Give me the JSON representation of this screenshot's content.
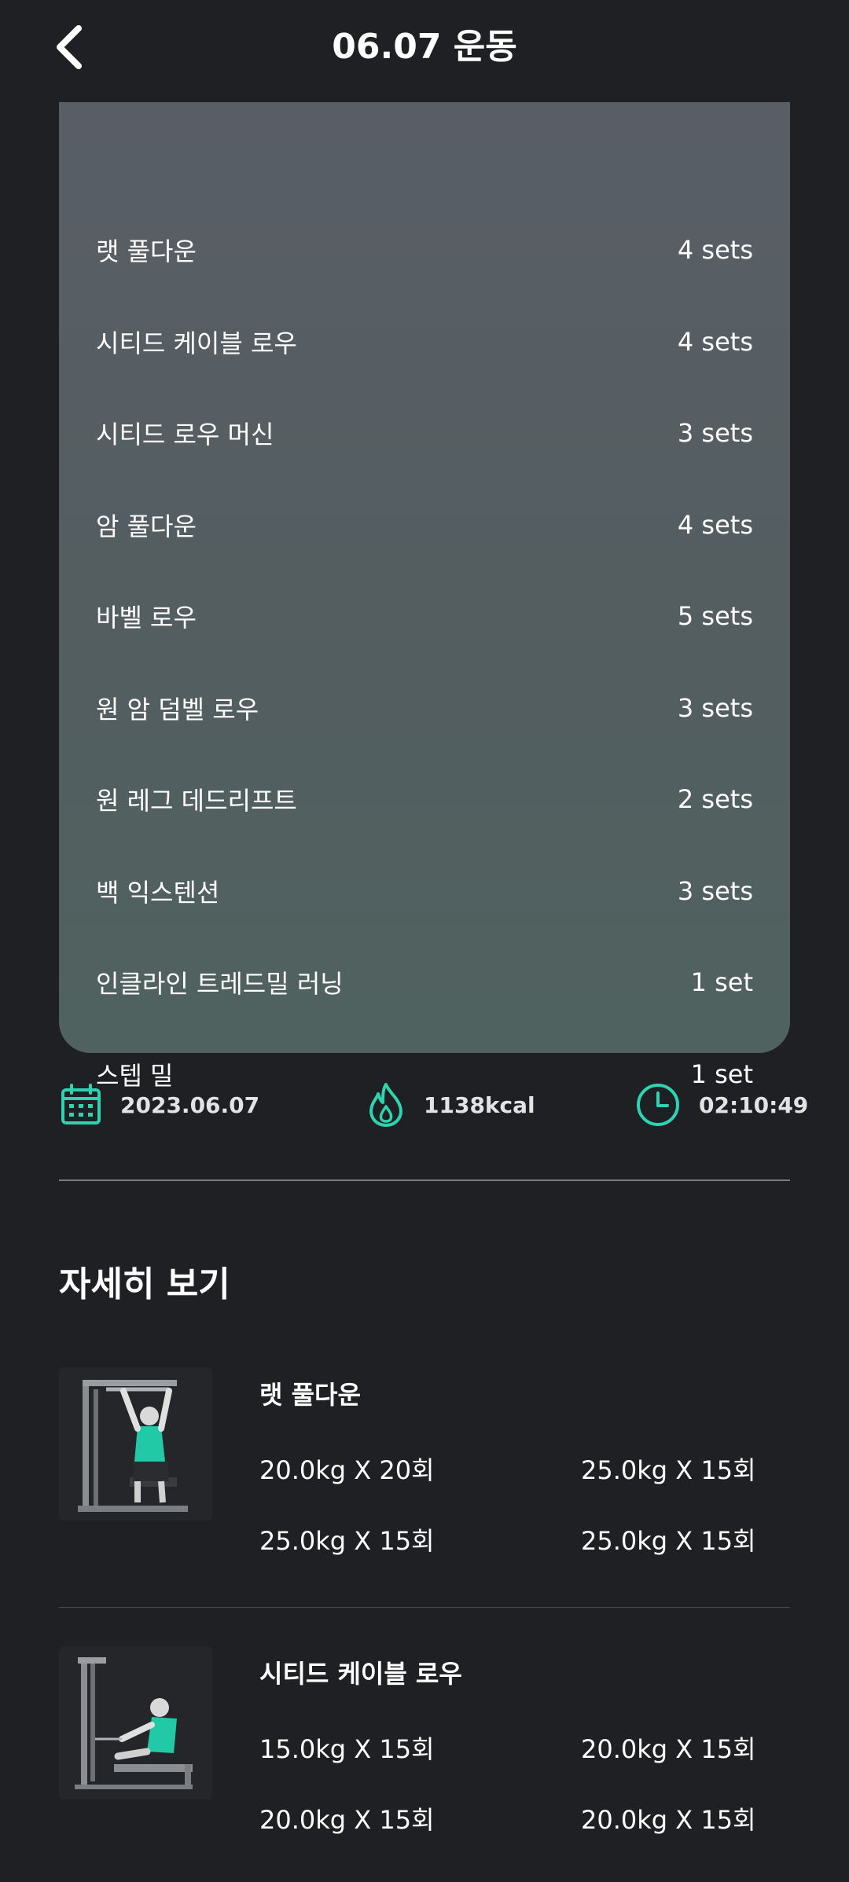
{
  "header": {
    "title": "06.07 운동"
  },
  "summary": {
    "items": [
      {
        "name": "랫 풀다운",
        "sets": "4 sets"
      },
      {
        "name": "시티드 케이블 로우",
        "sets": "4 sets"
      },
      {
        "name": "시티드 로우 머신",
        "sets": "3 sets"
      },
      {
        "name": "암 풀다운",
        "sets": "4 sets"
      },
      {
        "name": "바벨 로우",
        "sets": "5 sets"
      },
      {
        "name": "원 암 덤벨 로우",
        "sets": "3 sets"
      },
      {
        "name": "원 레그 데드리프트",
        "sets": "2 sets"
      },
      {
        "name": "백 익스텐션",
        "sets": "3 sets"
      },
      {
        "name": "인클라인 트레드밀 러닝",
        "sets": "1 set"
      },
      {
        "name": "스텝 밀",
        "sets": "1 set"
      }
    ]
  },
  "stats": {
    "date": "2023.06.07",
    "calories": "1138kcal",
    "duration": "02:10:49",
    "icons": [
      "calendar-icon",
      "flame-icon",
      "clock-icon"
    ],
    "accent_color": "#2ed3b0"
  },
  "details": {
    "title": "자세히 보기",
    "exercises": [
      {
        "name": "랫 풀다운",
        "sets": [
          "20.0kg X 20회",
          "25.0kg X 15회",
          "25.0kg X 15회",
          "25.0kg X 15회"
        ]
      },
      {
        "name": "시티드 케이블 로우",
        "sets": [
          "15.0kg X 15회",
          "20.0kg X 15회",
          "20.0kg X 15회",
          "20.0kg X 15회"
        ]
      }
    ]
  }
}
